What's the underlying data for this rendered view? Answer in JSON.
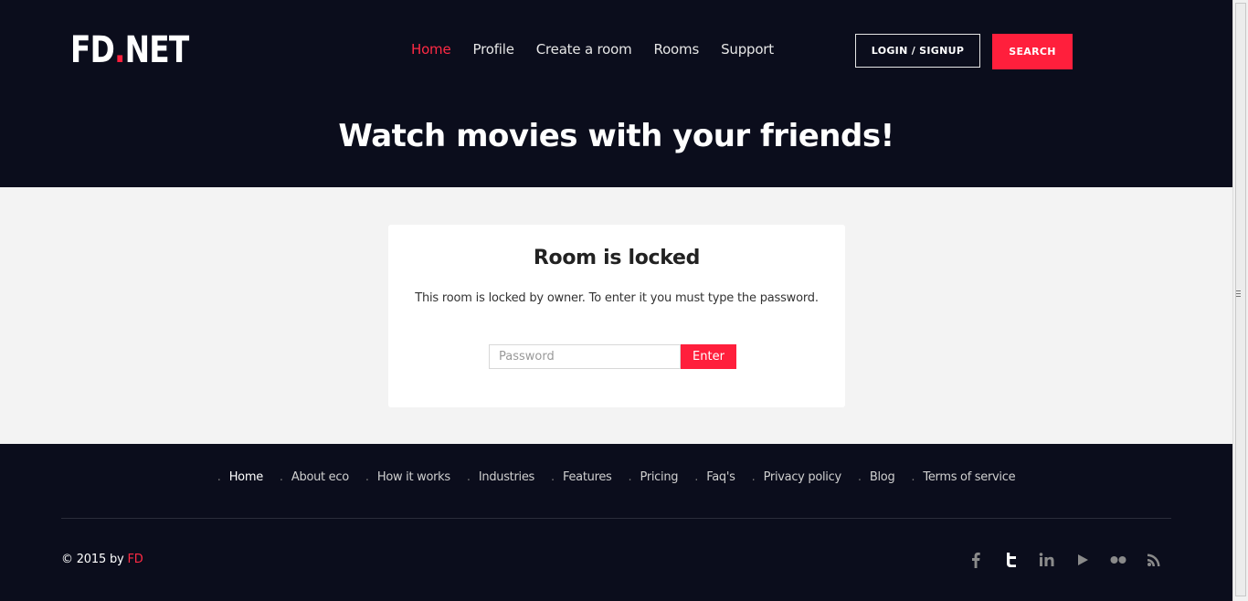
{
  "brand": {
    "logo_left": "FD",
    "logo_dot": ".",
    "logo_right": "NET"
  },
  "nav": {
    "items": [
      {
        "label": "Home",
        "active": true
      },
      {
        "label": "Profile"
      },
      {
        "label": "Create a room"
      },
      {
        "label": "Rooms"
      },
      {
        "label": "Support"
      }
    ],
    "login_label": "LOGIN / SIGNUP",
    "search_label": "SEARCH"
  },
  "hero": {
    "tagline": "Watch movies with your friends!"
  },
  "room": {
    "title": "Room is locked",
    "message": "This room is locked by owner. To enter it you must type the password.",
    "password_placeholder": "Password",
    "enter_label": "Enter"
  },
  "footer": {
    "links": [
      "Home",
      "About eco",
      "How it works",
      "Industries",
      "Features",
      "Pricing",
      "Faq's",
      "Privacy policy",
      "Blog",
      "Terms of service"
    ],
    "copyright_prefix": "© 2015 by ",
    "copyright_brand": "FD",
    "social_icons": [
      "facebook-icon",
      "twitter-icon",
      "linkedin-icon",
      "youtube-icon",
      "flickr-icon",
      "rss-icon"
    ]
  },
  "colors": {
    "accent": "#ff1f3c",
    "dark_bg": "#0b0d1c",
    "page_bg": "#f3f3f3"
  }
}
